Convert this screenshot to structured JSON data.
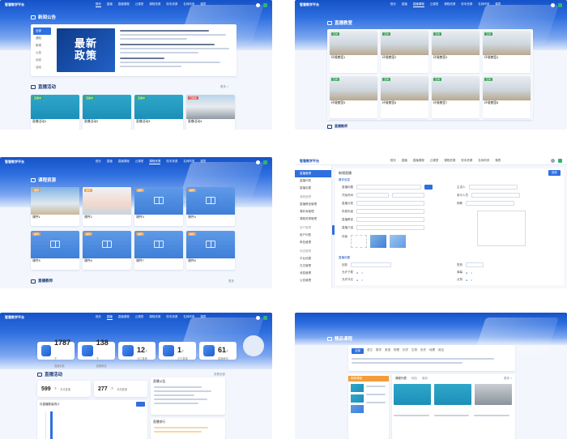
{
  "panels": {
    "news": {
      "logo": "智慧教学平台",
      "nav": [
        "首页",
        "直播",
        "直播课程",
        "云课堂",
        "课程资源",
        "校本资源",
        "名师风采",
        "课表"
      ],
      "section_title": "新闻公告",
      "tabs": [
        "全部",
        "通知",
        "新闻",
        "公告",
        "动态",
        "活动"
      ],
      "poster_text": "最新政策",
      "live_section_title": "直播活动",
      "live_more": "更多 >",
      "live_cards": [
        {
          "title": "直播活动1",
          "badge": "直播中"
        },
        {
          "title": "直播活动2",
          "badge": "直播中"
        },
        {
          "title": "直播活动3",
          "badge": "直播中"
        },
        {
          "title": "直播活动4",
          "badge": "已结束"
        }
      ]
    },
    "classrooms": {
      "logo": "智慧教学平台",
      "nav": [
        "首页",
        "直播",
        "直播课程",
        "云课堂",
        "课程资源",
        "校本资源",
        "名师风采",
        "课表"
      ],
      "section_title": "直播教室",
      "rooms": [
        {
          "title": "环境教室1",
          "badge": "空闲"
        },
        {
          "title": "环境教室2",
          "badge": "空闲"
        },
        {
          "title": "环境教室3",
          "badge": "空闲"
        },
        {
          "title": "环境教室4",
          "badge": "空闲"
        },
        {
          "title": "环境教室5",
          "badge": "空闲"
        },
        {
          "title": "环境教室6",
          "badge": "空闲"
        },
        {
          "title": "环境教室7",
          "badge": "空闲"
        },
        {
          "title": "环境教室8",
          "badge": "空闲"
        }
      ],
      "next_section": "直播教师"
    },
    "courses": {
      "logo": "智慧教学平台",
      "nav": [
        "首页",
        "直播",
        "直播课程",
        "云课堂",
        "课程资源",
        "校本资源",
        "名师风采",
        "课表"
      ],
      "section_title": "课程资源",
      "items": [
        {
          "title": "课件1",
          "badge": "推荐"
        },
        {
          "title": "课件2",
          "badge": "推荐"
        },
        {
          "title": "课件3",
          "badge": "推荐"
        },
        {
          "title": "课件4",
          "badge": "推荐"
        },
        {
          "title": "课件5",
          "badge": "推荐"
        },
        {
          "title": "课件6",
          "badge": "推荐"
        },
        {
          "title": "课件7",
          "badge": "推荐"
        },
        {
          "title": "课件8",
          "badge": "推荐"
        }
      ],
      "next_section": "直播教师",
      "next_more": "更多"
    },
    "admin": {
      "logo": "智慧教学平台",
      "nav": [
        "首页",
        "直播",
        "直播课程",
        "云课堂",
        "课程资源",
        "校本资源",
        "名师风采",
        "课表"
      ],
      "sidebar": [
        "直播管理",
        "直播列表",
        "直播设置",
        "课程管理",
        "直播教室管理",
        "课件库管理",
        "课程资源管理",
        "用户管理",
        "用户列表",
        "角色管理",
        "系统管理",
        "平台设置",
        "日志管理",
        "消息管理",
        "公告管理"
      ],
      "sidebar_active": 0,
      "form_title": "新增直播",
      "basic_info": "基本信息",
      "labels": [
        "直播标题",
        "开始时间",
        "直播分类",
        "所属年级",
        "直播教室",
        "直播介绍",
        "封面",
        "主讲人",
        "参与人员",
        "助教"
      ],
      "submit": "保存",
      "option_title": "直播设置",
      "option_labels": [
        "回放",
        "允许下载",
        "允许评论",
        "签到",
        "弹幕",
        "点赞"
      ]
    },
    "dashboard": {
      "logo": "智慧教学平台",
      "nav": [
        "首页",
        "直播",
        "直播课程",
        "云课堂",
        "课程资源",
        "校本资源",
        "名师风采",
        "课表"
      ],
      "stats": [
        {
          "value": "1787",
          "unit": "个",
          "label": "直播总数"
        },
        {
          "value": "138",
          "unit": "个",
          "label": "直播教室"
        },
        {
          "value": "12",
          "unit": "个",
          "label": "今日直播"
        },
        {
          "value": "1",
          "unit": "个",
          "label": "正在直播"
        },
        {
          "value": "61",
          "unit": "个",
          "label": "直播教师"
        }
      ],
      "section_title": "直播活动",
      "section_more": "查看全部",
      "sub_stats": [
        {
          "value": "599",
          "unit": "个",
          "label": "本月直播"
        },
        {
          "value": "277",
          "unit": "个",
          "label": "本周直播"
        }
      ],
      "chart_title": "月直播数量统计",
      "notice_title": "直播公告",
      "notice_title2": "直播排行"
    },
    "recommend": {
      "section_title": "精品课程",
      "filters": [
        "全部",
        "语文",
        "数学",
        "英语",
        "物理",
        "化学",
        "生物",
        "历史",
        "地理",
        "政治"
      ],
      "list_title": "推荐课程",
      "tabs": [
        "课程列表",
        "精品",
        "最新"
      ],
      "more": "更多 >"
    }
  },
  "colors": {
    "brand": "#2f6fe0",
    "live": "#3ca55c",
    "accent": "#f39c3c"
  }
}
